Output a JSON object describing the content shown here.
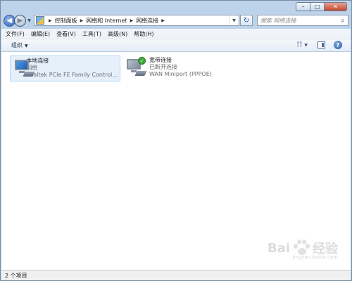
{
  "window": {
    "caption": {
      "minimize": "–",
      "maximize": "□",
      "close": "✕"
    }
  },
  "nav": {
    "back_glyph": "◀",
    "forward_glyph": "▶",
    "dropdown_glyph": "▼",
    "breadcrumbs": [
      "控制面板",
      "网络和 Internet",
      "网络连接"
    ],
    "refresh_glyph": "↻",
    "search_placeholder": "搜索 网络连接",
    "search_glyph": "⌕"
  },
  "menu": [
    "文件(F)",
    "编辑(E)",
    "查看(V)",
    "工具(T)",
    "高级(N)",
    "帮助(H)"
  ],
  "toolbar": {
    "organize_label": "组织",
    "dropdown_glyph": "▼",
    "view_glyph": "☷",
    "help_glyph": "?"
  },
  "connections": [
    {
      "name": "本地连接",
      "status": "网络",
      "device": "Realtek PCIe FE Family Control...",
      "selected": true,
      "badge": ""
    },
    {
      "name": "宽带连接",
      "status": "已断开连接",
      "device": "WAN Miniport (PPPOE)",
      "selected": false,
      "badge": "✓"
    }
  ],
  "status_bar": {
    "text": "2 个项目"
  },
  "watermark": {
    "brand": "Bai",
    "brand_cn": "经验",
    "url": "jingyan.baidu.com"
  }
}
